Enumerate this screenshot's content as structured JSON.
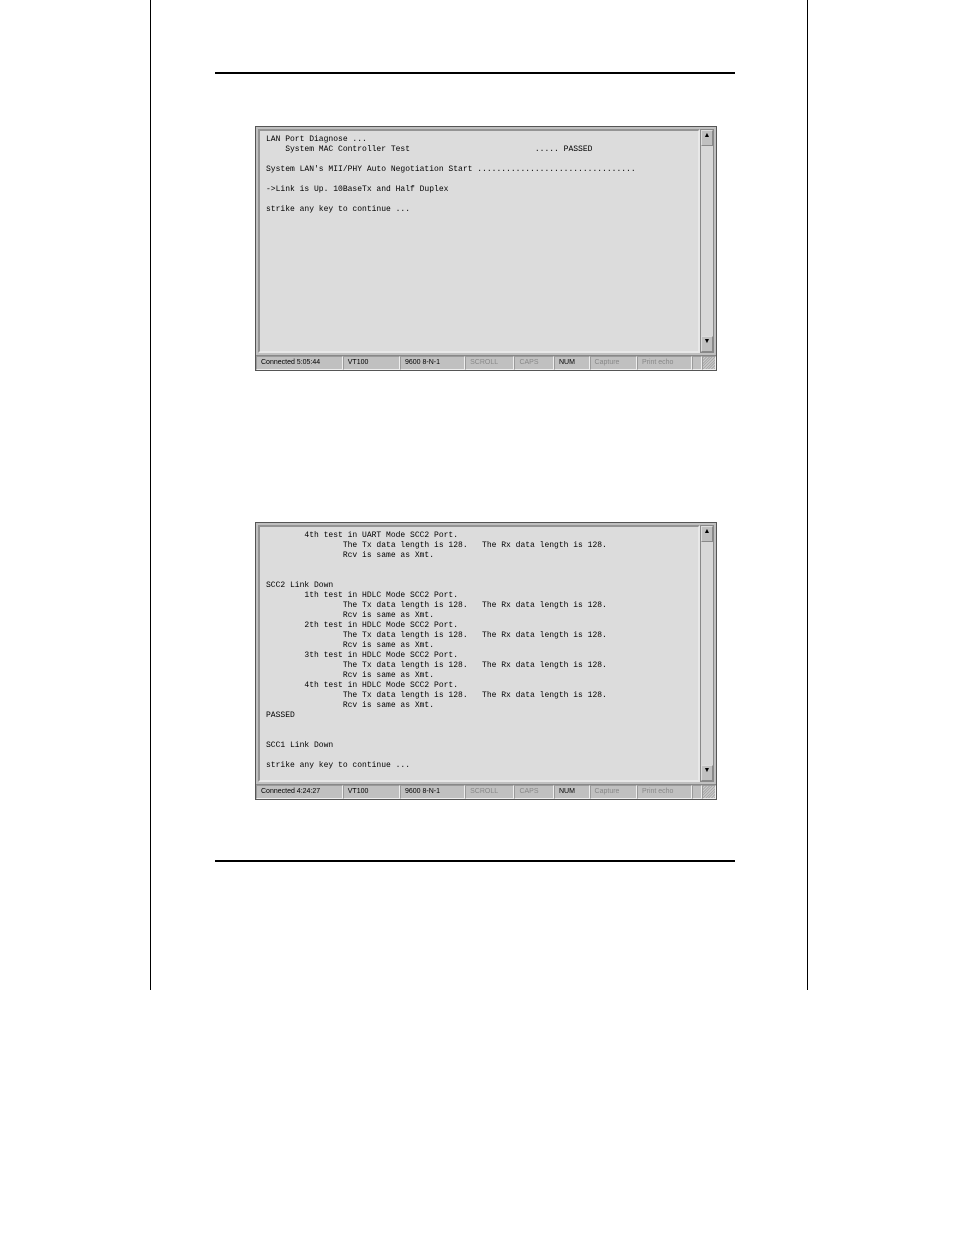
{
  "terminal1": {
    "text": "LAN Port Diagnose ...\n    System MAC Controller Test                          ..... PASSED\n\nSystem LAN's MII/PHY Auto Negotiation Start .................................\n\n->Link is Up. 10BaseTx and Half Duplex\n\nstrike any key to continue ...",
    "status": {
      "connected": "Connected 5:05:44",
      "emulation": "VT100",
      "settings": "9600 8-N-1",
      "scroll": "SCROLL",
      "caps": "CAPS",
      "num": "NUM",
      "capture": "Capture",
      "printecho": "Print echo"
    }
  },
  "terminal2": {
    "text": "        4th test in UART Mode SCC2 Port.\n                The Tx data length is 128.   The Rx data length is 128.\n                Rcv is same as Xmt.\n\n\nSCC2 Link Down\n        1th test in HDLC Mode SCC2 Port.\n                The Tx data length is 128.   The Rx data length is 128.\n                Rcv is same as Xmt.\n        2th test in HDLC Mode SCC2 Port.\n                The Tx data length is 128.   The Rx data length is 128.\n                Rcv is same as Xmt.\n        3th test in HDLC Mode SCC2 Port.\n                The Tx data length is 128.   The Rx data length is 128.\n                Rcv is same as Xmt.\n        4th test in HDLC Mode SCC2 Port.\n                The Tx data length is 128.   The Rx data length is 128.\n                Rcv is same as Xmt.\nPASSED\n\n\nSCC1 Link Down\n\nstrike any key to continue ...",
    "status": {
      "connected": "Connected 4:24:27",
      "emulation": "VT100",
      "settings": "9600 8-N-1",
      "scroll": "SCROLL",
      "caps": "CAPS",
      "num": "NUM",
      "capture": "Capture",
      "printecho": "Print echo"
    }
  }
}
